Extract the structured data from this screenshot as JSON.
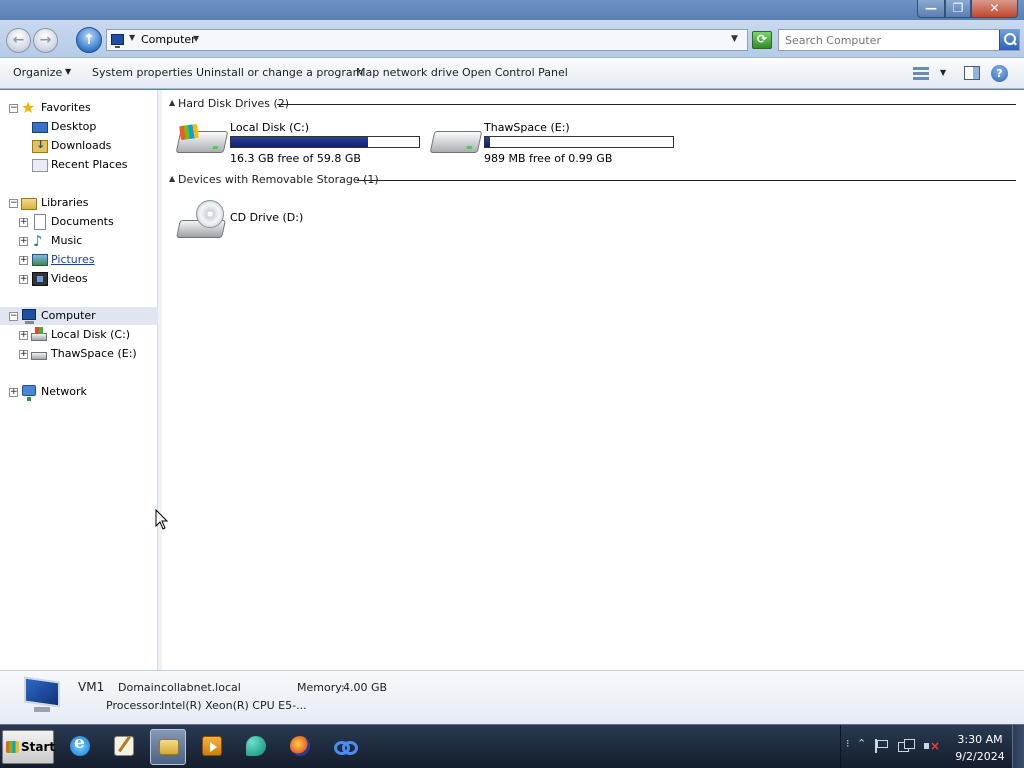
{
  "window": {
    "minimize_glyph": "—",
    "maximize_glyph": "❐",
    "close_glyph": "✕"
  },
  "nav": {
    "back_glyph": "←",
    "forward_glyph": "→",
    "up_glyph": "↑",
    "address_crumb": "Computer",
    "refresh_glyph": "⟳",
    "search_placeholder": "Search Computer"
  },
  "toolbar": {
    "organize": "Organize",
    "system_properties": "System properties",
    "uninstall": "Uninstall or change a program",
    "map_drive": "Map network drive",
    "control_panel": "Open Control Panel",
    "help_glyph": "?"
  },
  "sidebar": {
    "favorites": {
      "label": "Favorites",
      "icon": "star-icon"
    },
    "favorite_items": [
      {
        "label": "Desktop",
        "icon": "desktop-icon"
      },
      {
        "label": "Downloads",
        "icon": "downloads-icon"
      },
      {
        "label": "Recent Places",
        "icon": "recent-places-icon"
      }
    ],
    "libraries": {
      "label": "Libraries",
      "icon": "libraries-icon"
    },
    "library_items": [
      {
        "label": "Documents",
        "icon": "documents-icon"
      },
      {
        "label": "Music",
        "icon": "music-icon"
      },
      {
        "label": "Pictures",
        "icon": "pictures-icon"
      },
      {
        "label": "Videos",
        "icon": "videos-icon"
      }
    ],
    "computer": {
      "label": "Computer",
      "icon": "computer-icon",
      "selected": true
    },
    "computer_items": [
      {
        "label": "Local Disk (C:)",
        "icon": "local-disk-icon"
      },
      {
        "label": "ThawSpace (E:)",
        "icon": "drive-icon"
      }
    ],
    "network": {
      "label": "Network",
      "icon": "network-icon"
    },
    "collapse_glyph": "−",
    "expand_glyph": "+"
  },
  "content": {
    "hard_disk_group": "Hard Disk Drives (2)",
    "removable_group": "Devices with Removable Storage (1)",
    "drives": [
      {
        "name": "Local Disk (C:)",
        "free_text": "16.3 GB free of 59.8 GB",
        "used_fraction": 0.727
      },
      {
        "name": "ThawSpace (E:)",
        "free_text": "989 MB free of 0.99 GB",
        "used_fraction": 0.024
      }
    ],
    "removable": [
      {
        "name": "CD Drive (D:)"
      }
    ],
    "collapse_caret": "▲"
  },
  "details": {
    "computer_name": "VM1",
    "domain_label": "Domain:",
    "domain_value": "collabnet.local",
    "memory_label": "Memory:",
    "memory_value": "4.00 GB",
    "processor_label": "Processor:",
    "processor_value": "Intel(R) Xeon(R) CPU E5-..."
  },
  "taskbar": {
    "start_label": "Start",
    "apps": [
      {
        "name": "internet-explorer",
        "active": false
      },
      {
        "name": "notepad",
        "active": false
      },
      {
        "name": "windows-explorer",
        "active": true
      },
      {
        "name": "media-player",
        "active": false
      },
      {
        "name": "edge-browser",
        "active": false
      },
      {
        "name": "firefox",
        "active": false
      },
      {
        "name": "vm-tools",
        "active": false
      }
    ],
    "tray_expand": "⁝",
    "tray_up": "⌃",
    "clock_time": "3:30 AM",
    "clock_date": "9/2/2024"
  },
  "colors": {
    "accent": "#1f4fa3",
    "selection": "#dfe6ef",
    "drive_bar": "#1b2f85",
    "taskbar": "#1d2940"
  }
}
